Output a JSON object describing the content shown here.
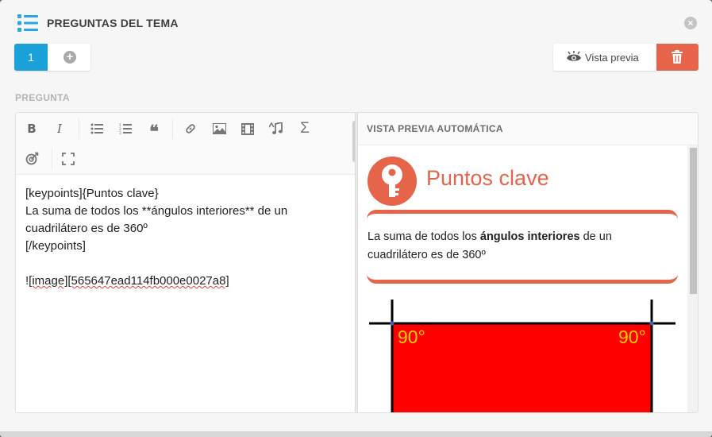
{
  "header": {
    "title": "PREGUNTAS DEL TEMA",
    "icon": "list-icon",
    "close_icon": "close-icon"
  },
  "tabs": {
    "active_label": "1",
    "add_icon": "plus-icon"
  },
  "actions": {
    "preview_label": "Vista previa",
    "delete_icon": "trash-icon"
  },
  "section_label": "PREGUNTA",
  "toolbar": {
    "buttons": [
      "bold-icon",
      "italic-icon",
      "unordered-list-icon",
      "ordered-list-icon",
      "quote-icon",
      "link-icon",
      "image-icon",
      "video-icon",
      "audio-icon",
      "formula-icon",
      "keypoint-icon",
      "fullscreen-icon"
    ]
  },
  "editor": {
    "lines": [
      "[keypoints]{Puntos clave}",
      "La suma de todos los **ángulos interiores** de un",
      "cuadrilátero es de 360º",
      "[/keypoints]",
      "",
      "![image][565647ead114fb000e0027a8]"
    ],
    "image_prefix": "!",
    "image_ref": "[image][565647ead114fb000e0027a8]"
  },
  "preview": {
    "header": "VISTA PREVIA AUTOMÁTICA",
    "keypoints_title": "Puntos clave",
    "keypoints_text_before": "La suma de todos los ",
    "keypoints_text_bold": "ángulos interiores",
    "keypoints_text_after": " de un cuadrilátero es de 360º",
    "angle_left": "90°",
    "angle_right": "90°"
  },
  "colors": {
    "accent": "#e6644a",
    "tab_active": "#1aa1d9",
    "shape_fill": "#ff0000",
    "angle_text": "#ffd000"
  }
}
